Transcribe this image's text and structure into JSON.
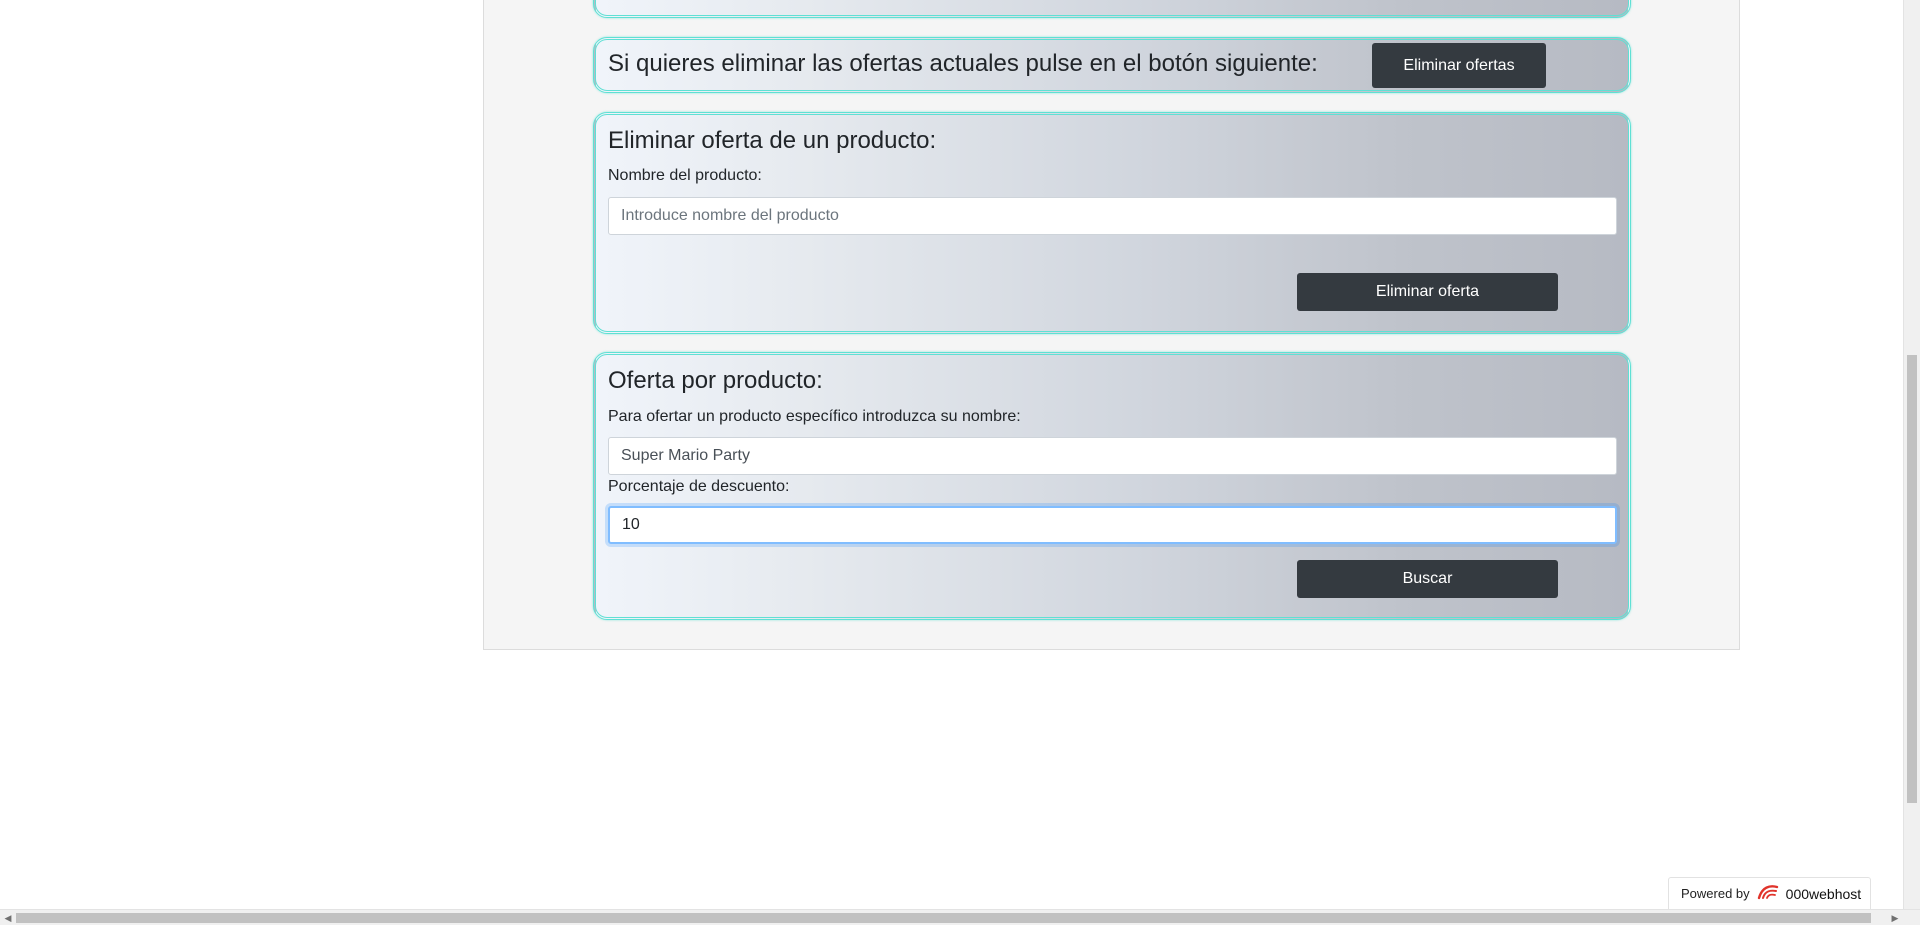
{
  "delete_all": {
    "text": "Si quieres eliminar las ofertas actuales pulse en el botón siguiente:",
    "button_label": "Eliminar ofertas"
  },
  "delete_one": {
    "title": "Eliminar oferta de un producto:",
    "name_label": "Nombre del producto:",
    "name_placeholder": "Introduce nombre del producto",
    "name_value": "",
    "button_label": "Eliminar oferta"
  },
  "offer": {
    "title": "Oferta por producto:",
    "product_label": "Para ofertar un producto específico introduzca su nombre:",
    "product_value": "Super Mario Party",
    "discount_label": "Porcentaje de descuento:",
    "discount_value": "10",
    "button_label": "Buscar"
  },
  "footer": {
    "powered_by": "Powered by",
    "brand": "000webhost",
    "brand_icon": "000webhost-logo-icon"
  },
  "colors": {
    "button_bg": "#343a40",
    "card_border": "#5fe0d4",
    "focus_border": "#80bdff"
  }
}
